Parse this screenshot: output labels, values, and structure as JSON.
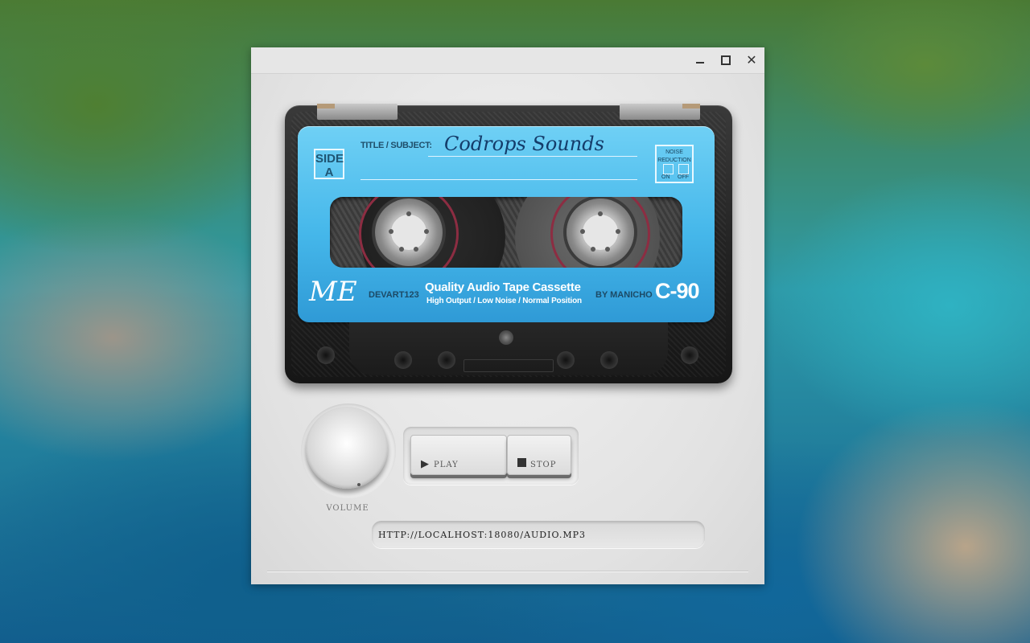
{
  "window": {
    "minimize_glyph": "",
    "maximize_glyph": "",
    "close_glyph": "✕"
  },
  "cassette": {
    "side_line1": "SIDE",
    "side_line2": "A",
    "title_label": "TITLE / SUBJECT:",
    "title_value": "Codrops Sounds",
    "noise_reduction_title": "NOISE REDUCTION",
    "noise_on": "ON",
    "noise_off": "OFF",
    "brand_logo": "ME",
    "brand_code": "DEVART123",
    "quality_title": "Quality Audio Tape Cassette",
    "quality_sub": "High Output / Low Noise / Normal Position",
    "by_label": "BY MANICHO",
    "tape_type": "C-90"
  },
  "controls": {
    "volume_label": "VOLUME",
    "play_label": "PLAY",
    "play_icon": "▶",
    "stop_label": "STOP"
  },
  "url": {
    "value": "HTTP://LOCALHOST:18080/AUDIO.MP3"
  }
}
